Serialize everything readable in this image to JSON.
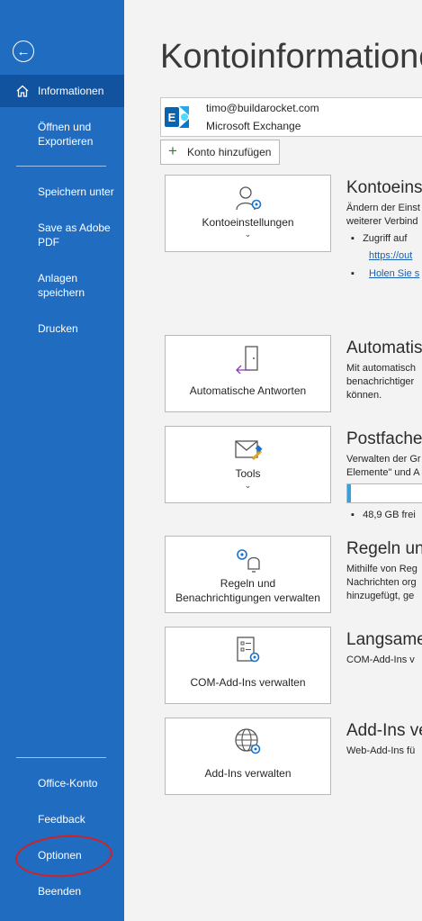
{
  "sidebar": {
    "active_item": "Informationen",
    "items": [
      "Informationen",
      "Öffnen und Exportieren",
      "Speichern unter",
      "Save as Adobe PDF",
      "Anlagen speichern",
      "Drucken"
    ],
    "bottom_items": [
      "Office-Konto",
      "Feedback",
      "Optionen",
      "Beenden"
    ]
  },
  "main": {
    "title": "Kontoinformationen",
    "account": {
      "email": "timo@buildarocket.com",
      "type": "Microsoft Exchange"
    },
    "add_account_label": "Konto hinzufügen",
    "sections": [
      {
        "card_label": "Kontoeinstellungen",
        "title": "Kontoeinstellungen",
        "desc": [
          "Ändern der Einst",
          "weiterer Verbind"
        ],
        "bullet": "Zugriff auf",
        "links": [
          "https://out",
          "Holen Sie s"
        ]
      },
      {
        "card_label": "Automatische Antworten",
        "title": "Automatis",
        "desc": [
          "Mit automatisch",
          "benachrichtiger",
          "können."
        ]
      },
      {
        "card_label": "Tools",
        "title": "Postfachei",
        "desc": [
          "Verwalten der Gr",
          "Elemente\" und A"
        ],
        "storage_text": "48,9 GB frei",
        "storage_fill_fraction": 0.03
      },
      {
        "card_label": [
          "Regeln und",
          "Benachrichtigungen verwalten"
        ],
        "title": "Regeln und",
        "desc": [
          "Mithilfe von Reg",
          "Nachrichten org",
          "hinzugefügt, ge"
        ]
      },
      {
        "card_label": "COM-Add-Ins verwalten",
        "title": "Langsame",
        "desc": [
          "COM-Add-Ins v"
        ]
      },
      {
        "card_label": "Add-Ins verwalten",
        "title": "Add-Ins ve",
        "desc": [
          "Web-Add-Ins fü"
        ]
      }
    ]
  },
  "icons": {
    "back": "back-arrow-icon",
    "home": "home-icon",
    "exchange": "exchange-icon",
    "plus": "plus-icon"
  },
  "colors": {
    "sidebar": "#1f6cc1",
    "sidebar_active": "#1253a0",
    "annotation": "#d42020"
  }
}
